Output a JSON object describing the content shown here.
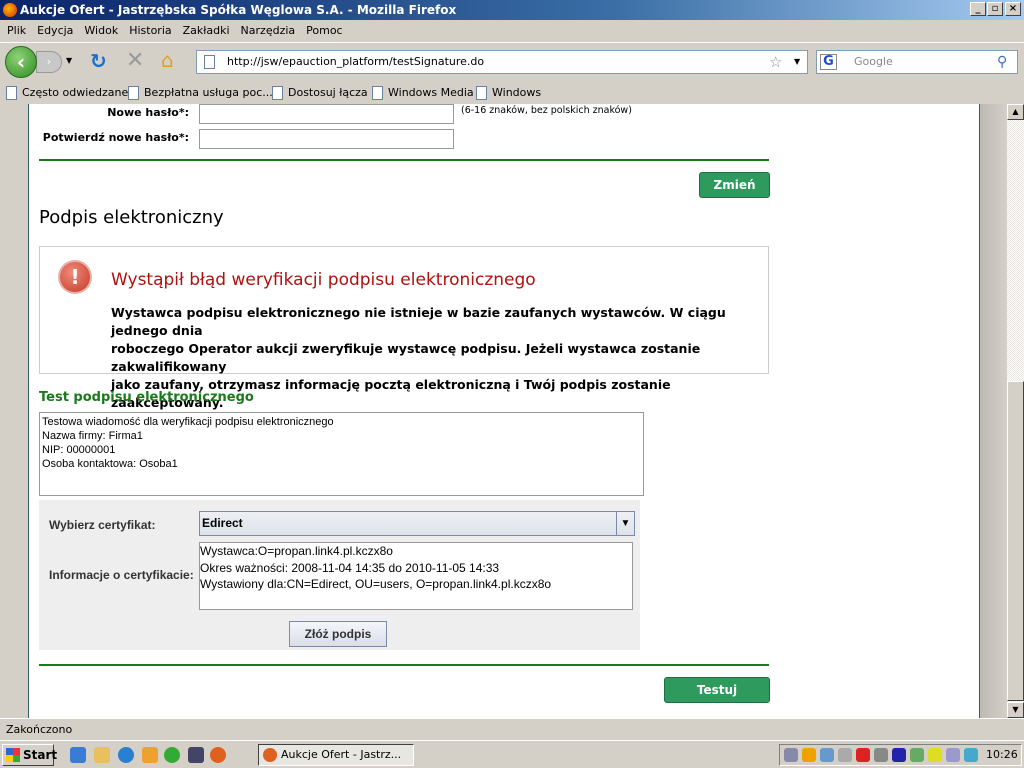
{
  "window": {
    "title": "Aukcje Ofert - Jastrzębska Spółka Węglowa S.A. - Mozilla Firefox"
  },
  "menu": [
    "Plik",
    "Edycja",
    "Widok",
    "Historia",
    "Zakładki",
    "Narzędzia",
    "Pomoc"
  ],
  "nav": {
    "url": "http://jsw/epauction_platform/testSignature.do",
    "search_placeholder": "Google"
  },
  "bookmarks": [
    "Często odwiedzane",
    "Bezpłatna usługa poc...",
    "Dostosuj łącza",
    "Windows Media",
    "Windows"
  ],
  "password_form": {
    "new_label": "Nowe hasło*:",
    "new_hint": "(6-16 znaków, bez polskich znaków)",
    "confirm_label": "Potwierdź nowe hasło*:",
    "new_value": "",
    "confirm_value": "",
    "change_button": "Zmień"
  },
  "signature": {
    "heading": "Podpis elektroniczny",
    "error": {
      "title": "Wystąpił błąd weryfikacji podpisu elektronicznego",
      "lines": [
        "Wystawca podpisu elektronicznego nie istnieje w bazie zaufanych wystawców. W ciągu jednego dnia",
        "roboczego Operator aukcji zweryfikuje wystawcę podpisu. Jeżeli wystawca zostanie zakwalifikowany",
        "jako zaufany, otrzymasz informację pocztą elektroniczną i Twój podpis zostanie zaakceptowany."
      ]
    },
    "test_heading": "Test podpisu elektronicznego",
    "message_lines": [
      "Testowa wiadomość dla weryfikacji podpisu elektronicznego",
      "Nazwa firmy: Firma1",
      "NIP: 00000001",
      "Osoba kontaktowa: Osoba1"
    ],
    "cert_label": "Wybierz certyfikat:",
    "cert_value": "Edirect",
    "info_label": "Informacje o certyfikacie:",
    "info_lines": [
      "Wystawca:O=propan.link4.pl.kczx8o",
      "Okres ważności: 2008-11-04 14:35 do 2010-11-05 14:33",
      "Wystawiony dla:CN=Edirect, OU=users, O=propan.link4.pl.kczx8o"
    ],
    "sign_button": "Złóż podpis",
    "test_button": "Testuj"
  },
  "status": "Zakończono",
  "taskbar": {
    "start": "Start",
    "task": "Aukcje Ofert - Jastrz...",
    "clock": "10:26"
  }
}
